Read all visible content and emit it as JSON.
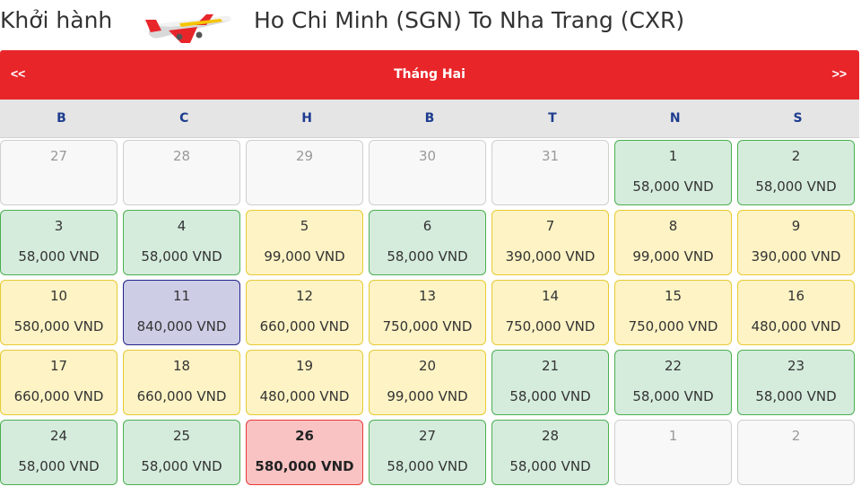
{
  "header": {
    "depart_label": "Khởi hành",
    "route": "Ho Chi Minh (SGN) To Nha Trang (CXR)"
  },
  "calendar": {
    "prev": "<<",
    "next": ">>",
    "month": "Tháng Hai",
    "weekdays": [
      "B",
      "C",
      "H",
      "B",
      "T",
      "N",
      "S"
    ],
    "cells": [
      {
        "day": "27",
        "price": "",
        "state": "empty"
      },
      {
        "day": "28",
        "price": "",
        "state": "empty"
      },
      {
        "day": "29",
        "price": "",
        "state": "empty"
      },
      {
        "day": "30",
        "price": "",
        "state": "empty"
      },
      {
        "day": "31",
        "price": "",
        "state": "empty"
      },
      {
        "day": "1",
        "price": "58,000 VND",
        "state": "green"
      },
      {
        "day": "2",
        "price": "58,000 VND",
        "state": "green"
      },
      {
        "day": "3",
        "price": "58,000 VND",
        "state": "green"
      },
      {
        "day": "4",
        "price": "58,000 VND",
        "state": "green"
      },
      {
        "day": "5",
        "price": "99,000 VND",
        "state": "yellow"
      },
      {
        "day": "6",
        "price": "58,000 VND",
        "state": "green"
      },
      {
        "day": "7",
        "price": "390,000 VND",
        "state": "yellow"
      },
      {
        "day": "8",
        "price": "99,000 VND",
        "state": "yellow"
      },
      {
        "day": "9",
        "price": "390,000 VND",
        "state": "yellow"
      },
      {
        "day": "10",
        "price": "580,000 VND",
        "state": "yellow"
      },
      {
        "day": "11",
        "price": "840,000 VND",
        "state": "purple"
      },
      {
        "day": "12",
        "price": "660,000 VND",
        "state": "yellow"
      },
      {
        "day": "13",
        "price": "750,000 VND",
        "state": "yellow"
      },
      {
        "day": "14",
        "price": "750,000 VND",
        "state": "yellow"
      },
      {
        "day": "15",
        "price": "750,000 VND",
        "state": "yellow"
      },
      {
        "day": "16",
        "price": "480,000 VND",
        "state": "yellow"
      },
      {
        "day": "17",
        "price": "660,000 VND",
        "state": "yellow"
      },
      {
        "day": "18",
        "price": "660,000 VND",
        "state": "yellow"
      },
      {
        "day": "19",
        "price": "480,000 VND",
        "state": "yellow"
      },
      {
        "day": "20",
        "price": "99,000 VND",
        "state": "yellow"
      },
      {
        "day": "21",
        "price": "58,000 VND",
        "state": "green"
      },
      {
        "day": "22",
        "price": "58,000 VND",
        "state": "green"
      },
      {
        "day": "23",
        "price": "58,000 VND",
        "state": "green"
      },
      {
        "day": "24",
        "price": "58,000 VND",
        "state": "green"
      },
      {
        "day": "25",
        "price": "58,000 VND",
        "state": "green"
      },
      {
        "day": "26",
        "price": "580,000 VND",
        "state": "red"
      },
      {
        "day": "27",
        "price": "58,000 VND",
        "state": "green"
      },
      {
        "day": "28",
        "price": "58,000 VND",
        "state": "green"
      },
      {
        "day": "1",
        "price": "",
        "state": "empty"
      },
      {
        "day": "2",
        "price": "",
        "state": "empty"
      }
    ]
  },
  "colors": {
    "header_red": "#e8262a",
    "weekday_blue": "#1e3d8f",
    "cheap_green": "#d5ecdd",
    "mid_yellow": "#fdf3c4",
    "high_purple": "#cdcde6",
    "selected_red": "#f9c3c3"
  },
  "icons": {
    "airline": "plane-icon"
  }
}
